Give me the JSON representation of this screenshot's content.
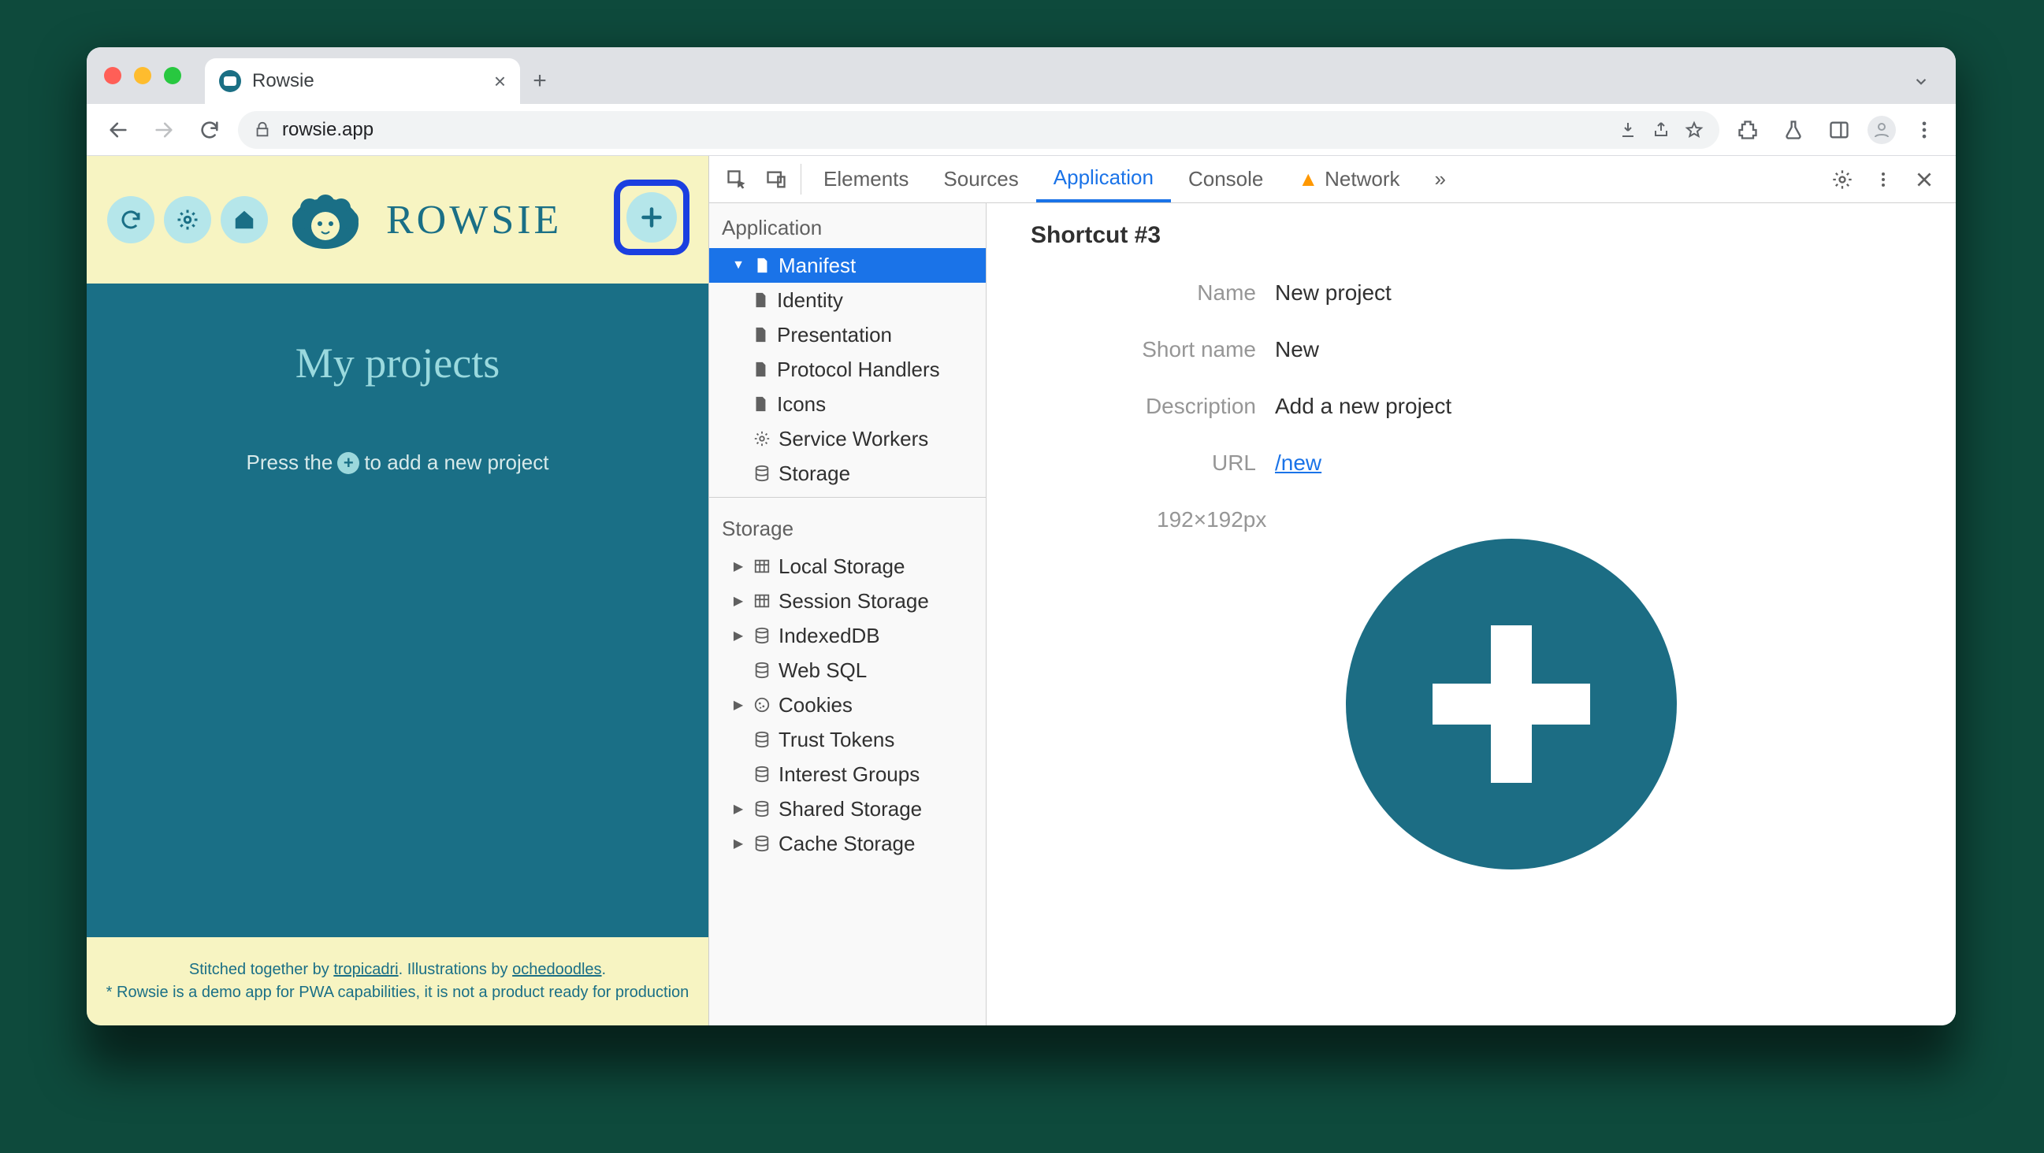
{
  "tab": {
    "title": "Rowsie"
  },
  "omnibox": {
    "url": "rowsie.app"
  },
  "app": {
    "logo_text": "ROWSIE",
    "projects_title": "My projects",
    "hint_prefix": "Press the",
    "hint_suffix": "to add a new project",
    "footer_line1_a": "Stitched together by ",
    "footer_link1": "tropicadri",
    "footer_line1_b": ". Illustrations by ",
    "footer_link2": "ochedoodles",
    "footer_line1_c": ".",
    "footer_line2": "* Rowsie is a demo app for PWA capabilities, it is not a product ready for production"
  },
  "devtools": {
    "tabs": [
      "Elements",
      "Sources",
      "Application",
      "Console",
      "Network"
    ],
    "active_tab": "Application",
    "network_has_warning": true,
    "sidebar": {
      "section1": "Application",
      "manifest": "Manifest",
      "manifest_children": [
        "Identity",
        "Presentation",
        "Protocol Handlers",
        "Icons"
      ],
      "service_workers": "Service Workers",
      "storage_app": "Storage",
      "section2": "Storage",
      "storage_items": [
        "Local Storage",
        "Session Storage",
        "IndexedDB",
        "Web SQL",
        "Cookies",
        "Trust Tokens",
        "Interest Groups",
        "Shared Storage",
        "Cache Storage"
      ],
      "storage_arrows": [
        true,
        true,
        true,
        false,
        true,
        false,
        false,
        true,
        true
      ]
    },
    "details": {
      "title": "Shortcut #3",
      "rows": [
        {
          "key": "Name",
          "val": "New project"
        },
        {
          "key": "Short name",
          "val": "New"
        },
        {
          "key": "Description",
          "val": "Add a new project"
        }
      ],
      "url_key": "URL",
      "url_val": "/new",
      "icon_dim": "192×192px"
    }
  }
}
